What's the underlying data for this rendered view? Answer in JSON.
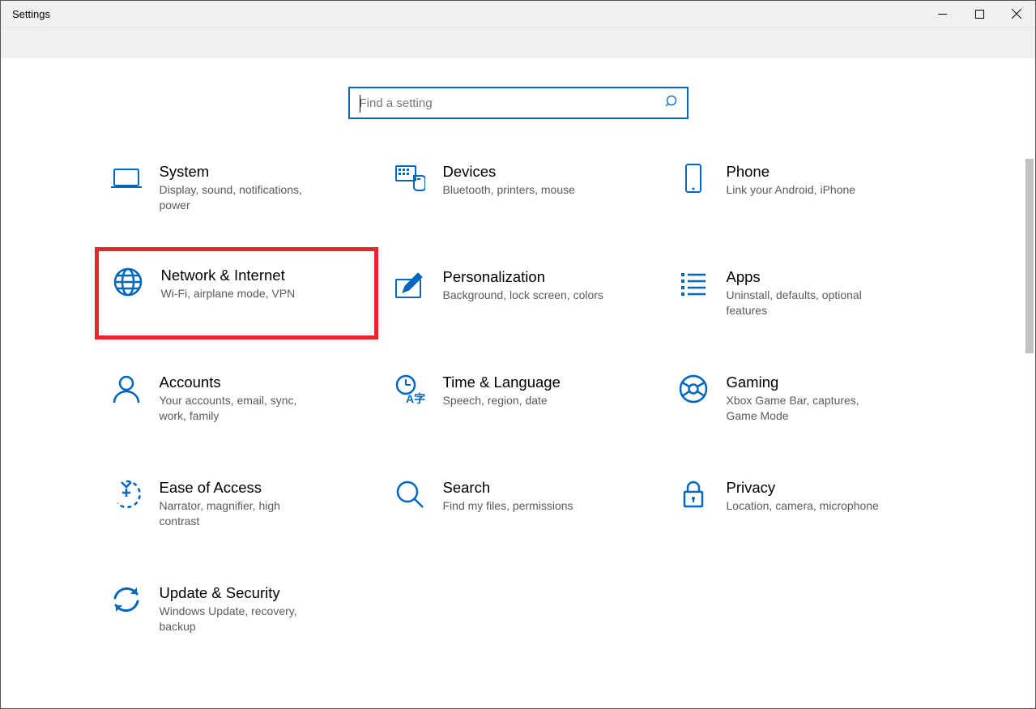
{
  "window": {
    "title": "Settings"
  },
  "search": {
    "placeholder": "Find a setting"
  },
  "categories": [
    {
      "id": "system",
      "icon": "laptop-icon",
      "title": "System",
      "desc": "Display, sound, notifications, power"
    },
    {
      "id": "devices",
      "icon": "devices-icon",
      "title": "Devices",
      "desc": "Bluetooth, printers, mouse"
    },
    {
      "id": "phone",
      "icon": "phone-icon",
      "title": "Phone",
      "desc": "Link your Android, iPhone"
    },
    {
      "id": "network",
      "icon": "globe-icon",
      "title": "Network & Internet",
      "desc": "Wi-Fi, airplane mode, VPN",
      "highlight": true
    },
    {
      "id": "personalization",
      "icon": "pen-icon",
      "title": "Personalization",
      "desc": "Background, lock screen, colors"
    },
    {
      "id": "apps",
      "icon": "apps-icon",
      "title": "Apps",
      "desc": "Uninstall, defaults, optional features"
    },
    {
      "id": "accounts",
      "icon": "person-icon",
      "title": "Accounts",
      "desc": "Your accounts, email, sync, work, family"
    },
    {
      "id": "time",
      "icon": "time-icon",
      "title": "Time & Language",
      "desc": "Speech, region, date"
    },
    {
      "id": "gaming",
      "icon": "gaming-icon",
      "title": "Gaming",
      "desc": "Xbox Game Bar, captures, Game Mode"
    },
    {
      "id": "ease",
      "icon": "ease-icon",
      "title": "Ease of Access",
      "desc": "Narrator, magnifier, high contrast"
    },
    {
      "id": "search",
      "icon": "search-big-icon",
      "title": "Search",
      "desc": "Find my files, permissions"
    },
    {
      "id": "privacy",
      "icon": "lock-icon",
      "title": "Privacy",
      "desc": "Location, camera, microphone"
    },
    {
      "id": "update",
      "icon": "update-icon",
      "title": "Update & Security",
      "desc": "Windows Update, recovery, backup"
    }
  ]
}
